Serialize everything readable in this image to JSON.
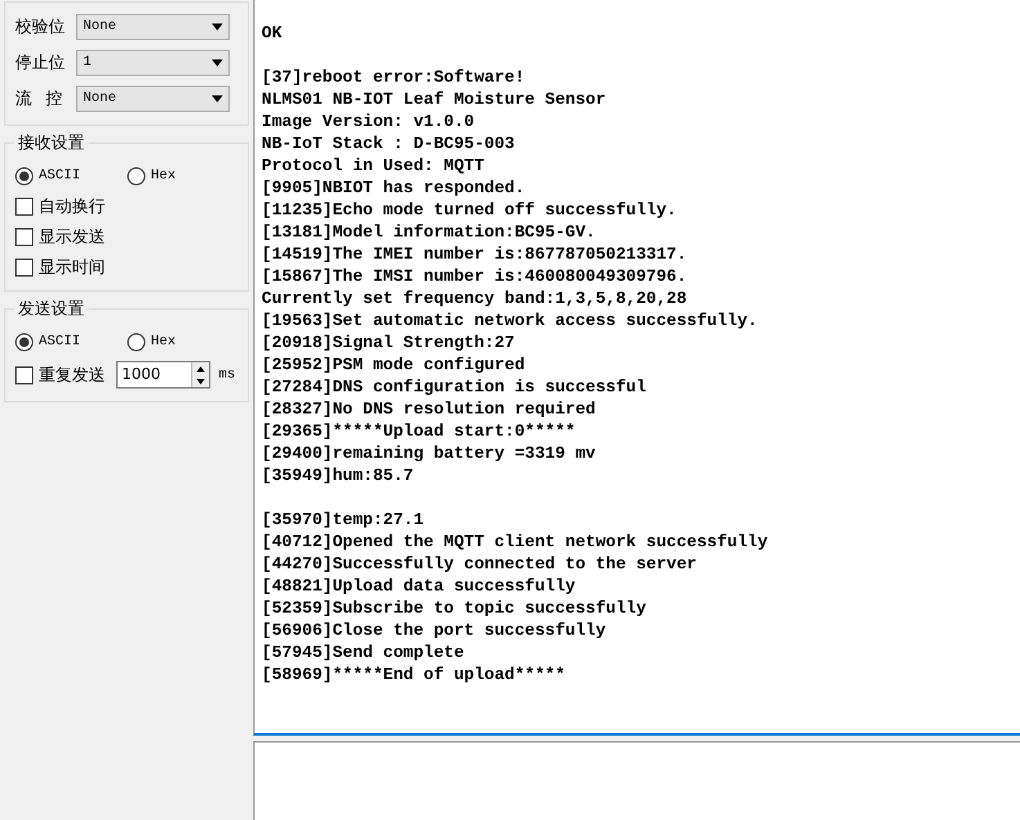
{
  "serial_settings": {
    "rows": [
      {
        "label": "校验位",
        "value": "None"
      },
      {
        "label": "停止位",
        "value": "1"
      },
      {
        "label": "流 控",
        "value": "None"
      }
    ]
  },
  "receive_settings": {
    "title": "接收设置",
    "modes": [
      {
        "label": "ASCII",
        "selected": true
      },
      {
        "label": "Hex",
        "selected": false
      }
    ],
    "options": [
      {
        "label": "自动换行",
        "checked": false
      },
      {
        "label": "显示发送",
        "checked": false
      },
      {
        "label": "显示时间",
        "checked": false
      }
    ]
  },
  "send_settings": {
    "title": "发送设置",
    "modes": [
      {
        "label": "ASCII",
        "selected": true
      },
      {
        "label": "Hex",
        "selected": false
      }
    ],
    "repeat": {
      "label": "重复发送",
      "checked": false,
      "interval": "1000",
      "unit": "ms"
    }
  },
  "log": {
    "blocks": [
      {
        "lines": [
          "OK"
        ]
      },
      {
        "lines": [
          "[37]reboot error:Software!",
          "NLMS01 NB-IOT Leaf Moisture Sensor",
          "Image Version: v1.0.0",
          "NB-IoT Stack : D-BC95-003",
          "Protocol in Used: MQTT",
          "[9905]NBIOT has responded.",
          "[11235]Echo mode turned off successfully.",
          "[13181]Model information:BC95-GV.",
          "[14519]The IMEI number is:867787050213317.",
          "[15867]The IMSI number is:460080049309796.",
          "Currently set frequency band:1,3,5,8,20,28",
          "[19563]Set automatic network access successfully.",
          "[20918]Signal Strength:27",
          "[25952]PSM mode configured",
          "[27284]DNS configuration is successful",
          "[28327]No DNS resolution required",
          "[29365]*****Upload start:0*****",
          "[29400]remaining battery =3319 mv",
          "[35949]hum:85.7"
        ]
      },
      {
        "lines": [
          "[35970]temp:27.1",
          "[40712]Opened the MQTT client network successfully",
          "[44270]Successfully connected to the server",
          "[48821]Upload data successfully",
          "[52359]Subscribe to topic successfully",
          "[56906]Close the port successfully",
          "[57945]Send complete",
          "[58969]*****End of upload*****"
        ]
      }
    ]
  }
}
